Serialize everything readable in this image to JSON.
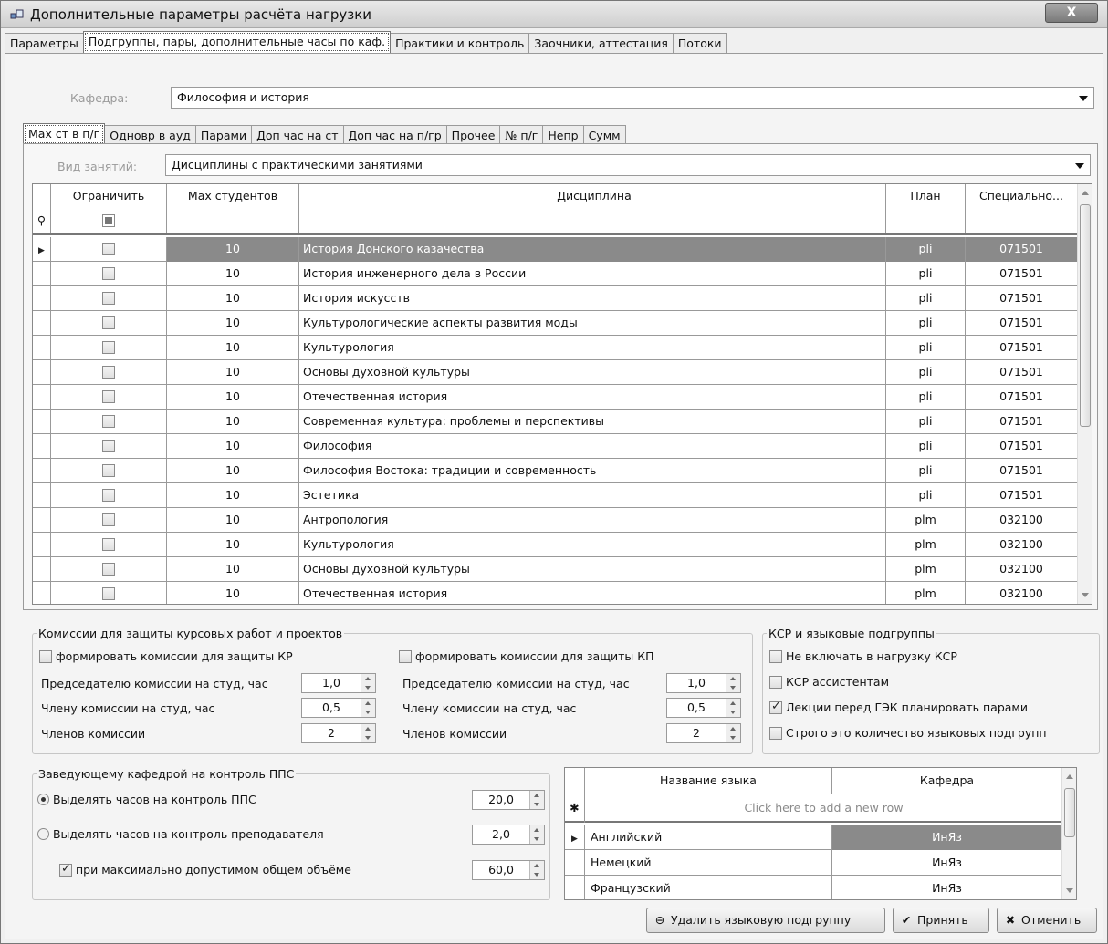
{
  "window": {
    "title": "Дополнительные параметры расчёта нагрузки",
    "close": "X"
  },
  "tabs_top": [
    "Параметры",
    "Подгруппы, пары, дополнительные часы по каф.",
    "Практики и контроль",
    "Заочники, аттестация",
    "Потоки"
  ],
  "kafedra": {
    "label": "Кафедра:",
    "value": "Философия и история"
  },
  "tabs_inner": [
    "Мах ст в п/г",
    "Одновр в ауд",
    "Парами",
    "Доп час на ст",
    "Доп час на п/гр",
    "Прочее",
    "№ п/г",
    "Непр",
    "Сумм"
  ],
  "vid": {
    "label": "Вид занятий:",
    "value": "Дисциплины с практическими занятиями"
  },
  "grid": {
    "headers": [
      "Ограничить",
      "Мах студентов",
      "Дисциплина",
      "План",
      "Специально..."
    ],
    "new_row_marker": "⚲",
    "rows": [
      {
        "max": "10",
        "disc": "История Донского казачества",
        "plan": "pli",
        "spec": "071501"
      },
      {
        "max": "10",
        "disc": "История инженерного дела в России",
        "plan": "pli",
        "spec": "071501"
      },
      {
        "max": "10",
        "disc": "История искусств",
        "plan": "pli",
        "spec": "071501"
      },
      {
        "max": "10",
        "disc": "Культурологические аспекты развития моды",
        "plan": "pli",
        "spec": "071501"
      },
      {
        "max": "10",
        "disc": "Культурология",
        "plan": "pli",
        "spec": "071501"
      },
      {
        "max": "10",
        "disc": "Основы духовной культуры",
        "plan": "pli",
        "spec": "071501"
      },
      {
        "max": "10",
        "disc": "Отечественная история",
        "plan": "pli",
        "spec": "071501"
      },
      {
        "max": "10",
        "disc": "Современная культура: проблемы и перспективы",
        "plan": "pli",
        "spec": "071501"
      },
      {
        "max": "10",
        "disc": "Философия",
        "plan": "pli",
        "spec": "071501"
      },
      {
        "max": "10",
        "disc": "Философия Востока: традиции и современность",
        "plan": "pli",
        "spec": "071501"
      },
      {
        "max": "10",
        "disc": "Эстетика",
        "plan": "pli",
        "spec": "071501"
      },
      {
        "max": "10",
        "disc": "Антропология",
        "plan": "plm",
        "spec": "032100"
      },
      {
        "max": "10",
        "disc": "Культурология",
        "plan": "plm",
        "spec": "032100"
      },
      {
        "max": "10",
        "disc": "Основы духовной культуры",
        "plan": "plm",
        "spec": "032100"
      },
      {
        "max": "10",
        "disc": "Отечественная история",
        "plan": "plm",
        "spec": "032100"
      }
    ]
  },
  "komissii": {
    "legend": "Комиссии для защиты курсовых работ и проектов",
    "kr": {
      "check": "формировать комиссии для защиты КР",
      "chair": "Председателю комиссии на студ, час",
      "chair_val": "1,0",
      "member": "Члену комиссии на студ, час",
      "member_val": "0,5",
      "count": "Членов комиссии",
      "count_val": "2"
    },
    "kp": {
      "check": "формировать комиссии для защиты КП",
      "chair": "Председателю комиссии на студ, час",
      "chair_val": "1,0",
      "member": "Члену комиссии на студ, час",
      "member_val": "0,5",
      "count": "Членов комиссии",
      "count_val": "2"
    }
  },
  "ksr": {
    "legend": "КСР и языковые подгруппы",
    "items": [
      {
        "label": "Не включать в нагрузку КСР",
        "checked": false
      },
      {
        "label": "КСР ассистентам",
        "checked": false
      },
      {
        "label": "Лекции перед ГЭК планировать парами",
        "checked": true
      },
      {
        "label": "Строго это количество языковых подгрупп",
        "checked": false
      }
    ]
  },
  "zav": {
    "legend": "Заведующему кафедрой на контроль ППС",
    "opt1": "Выделять часов на контроль ППС",
    "opt1_val": "20,0",
    "opt2": "Выделять часов на контроль преподавателя",
    "opt2_val": "2,0",
    "opt3": "при максимально допустимом общем объёме",
    "opt3_val": "60,0"
  },
  "lang_grid": {
    "headers": [
      "Название языка",
      "Кафедра"
    ],
    "new_row": "Click here to add a new row",
    "new_marker": "✱",
    "rows": [
      {
        "name": "Английский",
        "kaf": "ИнЯз"
      },
      {
        "name": "Немецкий",
        "kaf": "ИнЯз"
      },
      {
        "name": "Французский",
        "kaf": "ИнЯз"
      }
    ]
  },
  "buttons": {
    "delete": "Удалить языковую подгруппу",
    "accept": "Принять",
    "cancel": "Отменить"
  }
}
